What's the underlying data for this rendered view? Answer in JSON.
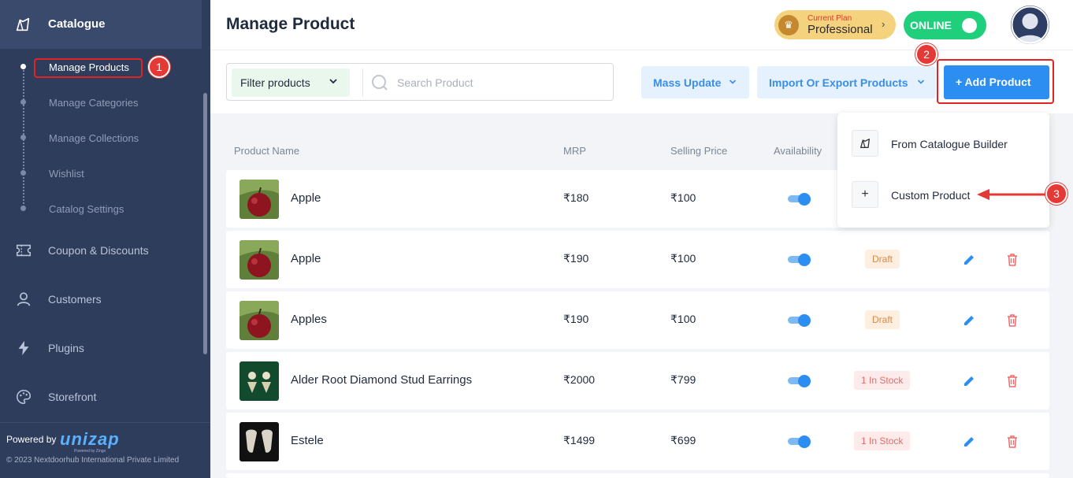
{
  "sidebar": {
    "header_label": "Catalogue",
    "sub_items": [
      {
        "label": "Manage Products"
      },
      {
        "label": "Manage Categories"
      },
      {
        "label": "Manage Collections"
      },
      {
        "label": "Wishlist"
      },
      {
        "label": "Catalog Settings"
      }
    ],
    "items": [
      {
        "label": "Coupon & Discounts",
        "icon": "coupon-icon"
      },
      {
        "label": "Customers",
        "icon": "user-icon"
      },
      {
        "label": "Plugins",
        "icon": "bolt-icon"
      },
      {
        "label": "Storefront",
        "icon": "palette-icon"
      }
    ],
    "footer": {
      "powered_by": "Powered by",
      "brand": "unizap",
      "brand_sub": "Powered by Zingo",
      "copyright": "© 2023 Nextdoorhub International Private Limited"
    }
  },
  "annotations": {
    "one": "1",
    "two": "2",
    "three": "3"
  },
  "header": {
    "title": "Manage Product",
    "plan_caption": "Current Plan",
    "plan_value": "Professional",
    "status_label": "ONLINE"
  },
  "toolbar": {
    "filter_label": "Filter products",
    "search_placeholder": "Search Product",
    "mass_update_label": "Mass Update",
    "import_export_label": "Import Or Export Products",
    "add_product_label": "+  Add Product"
  },
  "table": {
    "columns": [
      "Product Name",
      "MRP",
      "Selling Price",
      "Availability"
    ],
    "rows": [
      {
        "name": "Apple",
        "mrp": "₹180",
        "selling_price": "₹100",
        "available": true,
        "status": ""
      },
      {
        "name": "Apple",
        "mrp": "₹190",
        "selling_price": "₹100",
        "available": true,
        "status": "Draft"
      },
      {
        "name": "Apples",
        "mrp": "₹190",
        "selling_price": "₹100",
        "available": true,
        "status": "Draft"
      },
      {
        "name": "Alder Root Diamond Stud Earrings",
        "mrp": "₹2000",
        "selling_price": "₹799",
        "available": true,
        "status": "1 In Stock"
      },
      {
        "name": "Estele",
        "mrp": "₹1499",
        "selling_price": "₹699",
        "available": true,
        "status": "1 In Stock"
      }
    ]
  },
  "dropdown": {
    "items": [
      {
        "label": "From Catalogue Builder",
        "icon": "catalogue-icon"
      },
      {
        "label": "Custom Product",
        "icon": "plus-icon"
      }
    ]
  },
  "colors": {
    "sidebar_bg": "#2f3d5c",
    "accent_blue": "#2c8ef0",
    "online_green": "#1fcf7b",
    "annotation_red": "#e53935"
  }
}
